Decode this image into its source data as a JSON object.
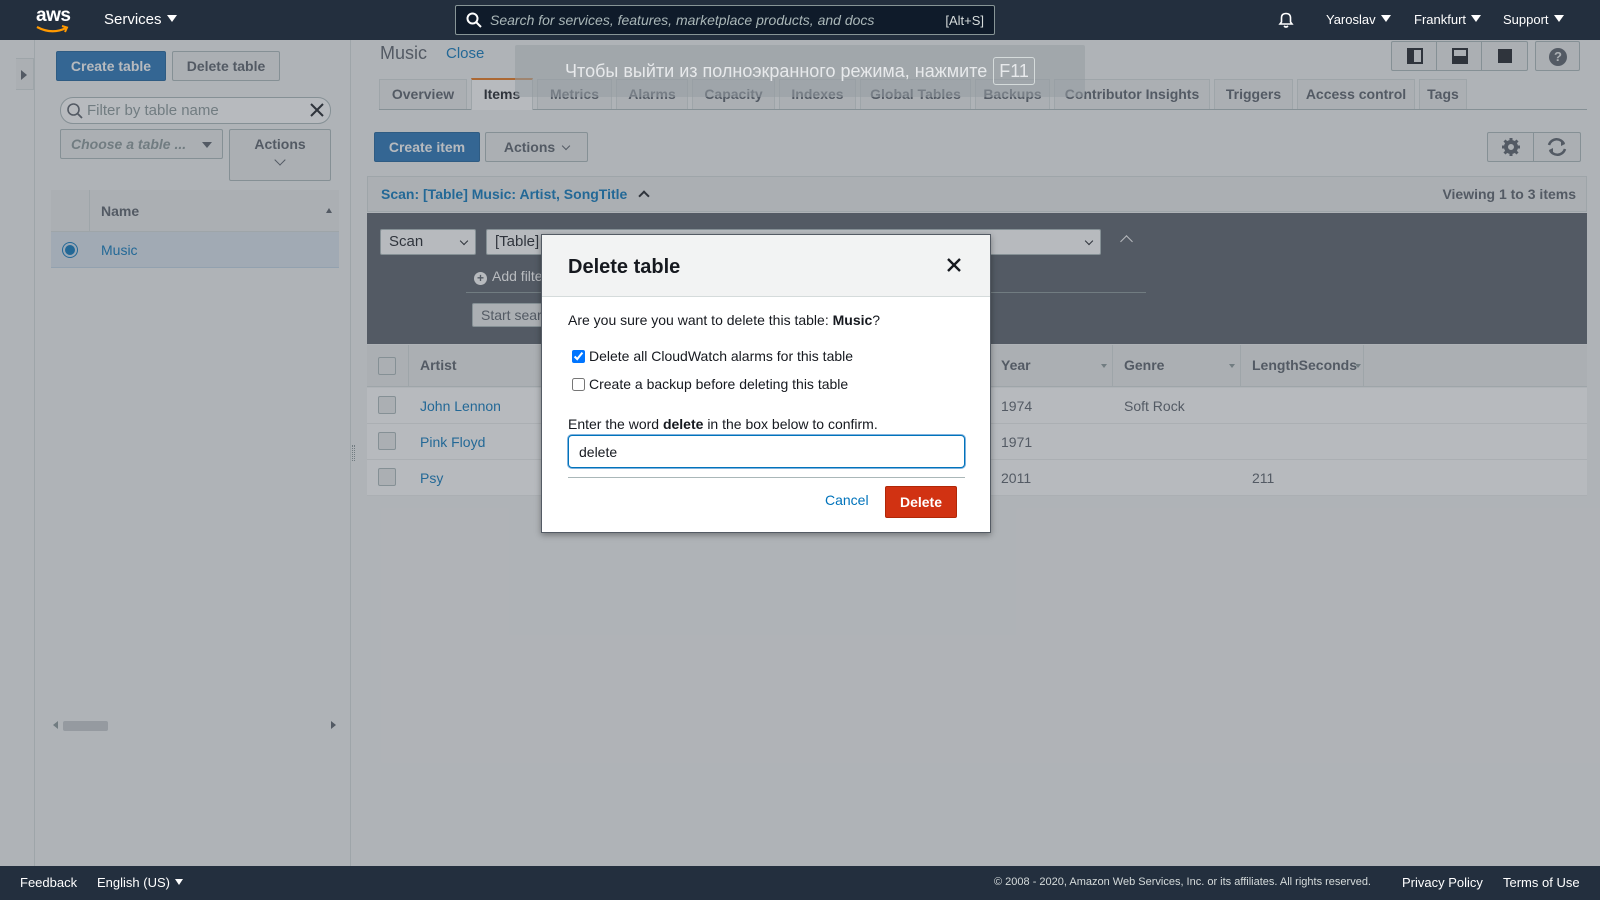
{
  "nav": {
    "brand": "aws",
    "services_label": "Services",
    "search_placeholder": "Search for services, features, marketplace products, and docs",
    "search_shortcut": "[Alt+S]",
    "user": "Yaroslav",
    "region": "Frankfurt",
    "support": "Support"
  },
  "left_panel": {
    "create_table": "Create table",
    "delete_table": "Delete table",
    "filter_placeholder": "Filter by table name",
    "choose_table": "Choose a table ...",
    "actions": "Actions",
    "column_name": "Name",
    "tables": [
      "Music"
    ]
  },
  "main": {
    "title": "Music",
    "close": "Close",
    "tabs": [
      "Overview",
      "Items",
      "Metrics",
      "Alarms",
      "Capacity",
      "Indexes",
      "Global Tables",
      "Backups",
      "Contributor Insights",
      "Triggers",
      "Access control",
      "Tags"
    ],
    "active_tab": "Items",
    "create_item": "Create item",
    "actions": "Actions",
    "scan_label": "Scan: [Table] Music: Artist, SongTitle",
    "viewing": "Viewing 1 to 3 items",
    "scan_mode": "Scan",
    "scan_target": "[Table]",
    "add_filter": "Add filte",
    "start_search": "Start search",
    "columns": [
      "Artist",
      "Year",
      "Genre",
      "LengthSeconds"
    ],
    "rows": [
      {
        "artist": "John Lennon",
        "year": "1974",
        "genre": "Soft Rock",
        "length": ""
      },
      {
        "artist": "Pink Floyd",
        "year": "1971",
        "genre": "",
        "length": ""
      },
      {
        "artist": "Psy",
        "year": "2011",
        "genre": "",
        "length": "211"
      }
    ]
  },
  "fullscreen_toast": {
    "text": "Чтобы выйти из полноэкранного режима, нажмите",
    "key": "F11"
  },
  "modal": {
    "title": "Delete table",
    "question_prefix": "Are you sure you want to delete this table:",
    "table_name": "Music",
    "question_suffix": "?",
    "checkbox_alarms": "Delete all CloudWatch alarms for this table",
    "checkbox_alarms_checked": true,
    "checkbox_backup": "Create a backup before deleting this table",
    "checkbox_backup_checked": false,
    "confirm_prefix": "Enter the word",
    "confirm_word": "delete",
    "confirm_suffix": "in the box below to confirm.",
    "confirm_value": "delete",
    "cancel": "Cancel",
    "delete": "Delete"
  },
  "footer": {
    "feedback": "Feedback",
    "language": "English (US)",
    "copyright": "© 2008 - 2020, Amazon Web Services, Inc. or its affiliates. All rights reserved.",
    "privacy": "Privacy Policy",
    "terms": "Terms of Use"
  },
  "colors": {
    "nav_bg": "#232f3e",
    "primary": "#1e6fb5",
    "link": "#0073bb",
    "danger": "#d13212",
    "tab_accent": "#ec7211"
  }
}
